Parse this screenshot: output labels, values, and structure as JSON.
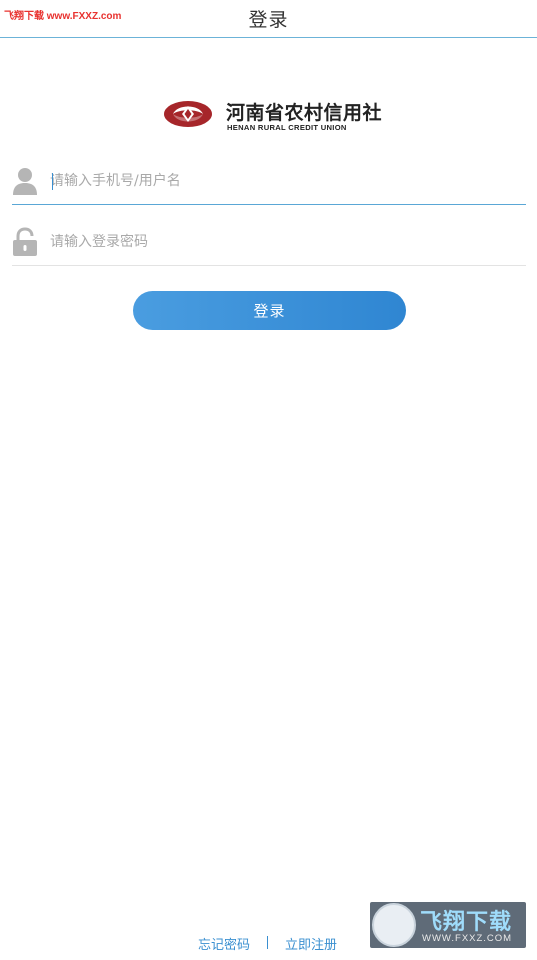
{
  "header": {
    "title": "登录",
    "watermark_text": "飞翔下载 www.FXXZ.com"
  },
  "logo": {
    "name_cn": "河南省农村信用社",
    "name_en": "HENAN RURAL CREDIT UNION",
    "brand_color": "#a6262a",
    "icon": "hnrcu-logo-icon"
  },
  "form": {
    "username": {
      "value": "",
      "placeholder": "请输入手机号/用户名",
      "icon": "user-icon"
    },
    "password": {
      "value": "",
      "placeholder": "请输入登录密码",
      "icon": "lock-icon"
    },
    "login_label": "登录",
    "accent_color": "#3a8fd0"
  },
  "footer": {
    "forgot_label": "忘记密码",
    "register_label": "立即注册"
  },
  "watermark_badge": {
    "text_cn": "飞翔下载",
    "text_en": "WWW.FXXZ.COM"
  }
}
